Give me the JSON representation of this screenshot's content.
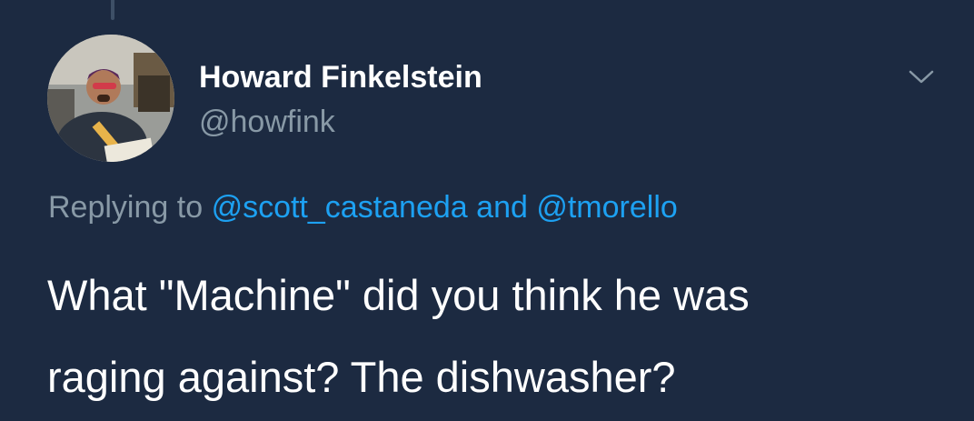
{
  "tweet": {
    "author": {
      "display_name": "Howard Finkelstein",
      "handle": "@howfink",
      "avatar": "profile-photo"
    },
    "menu_icon": "chevron-down-icon",
    "reply": {
      "prefix": "Replying to",
      "mention_1": "@scott_castaneda",
      "conjunction": "and",
      "mention_2": "@tmorello"
    },
    "text_line_1": "What \"Machine\" did you think he was",
    "text_line_2": "raging against? The dishwasher?"
  },
  "colors": {
    "background": "#1c2a41",
    "primary_text": "#ffffff",
    "secondary_text": "#8899a6",
    "link": "#1da1f2"
  }
}
